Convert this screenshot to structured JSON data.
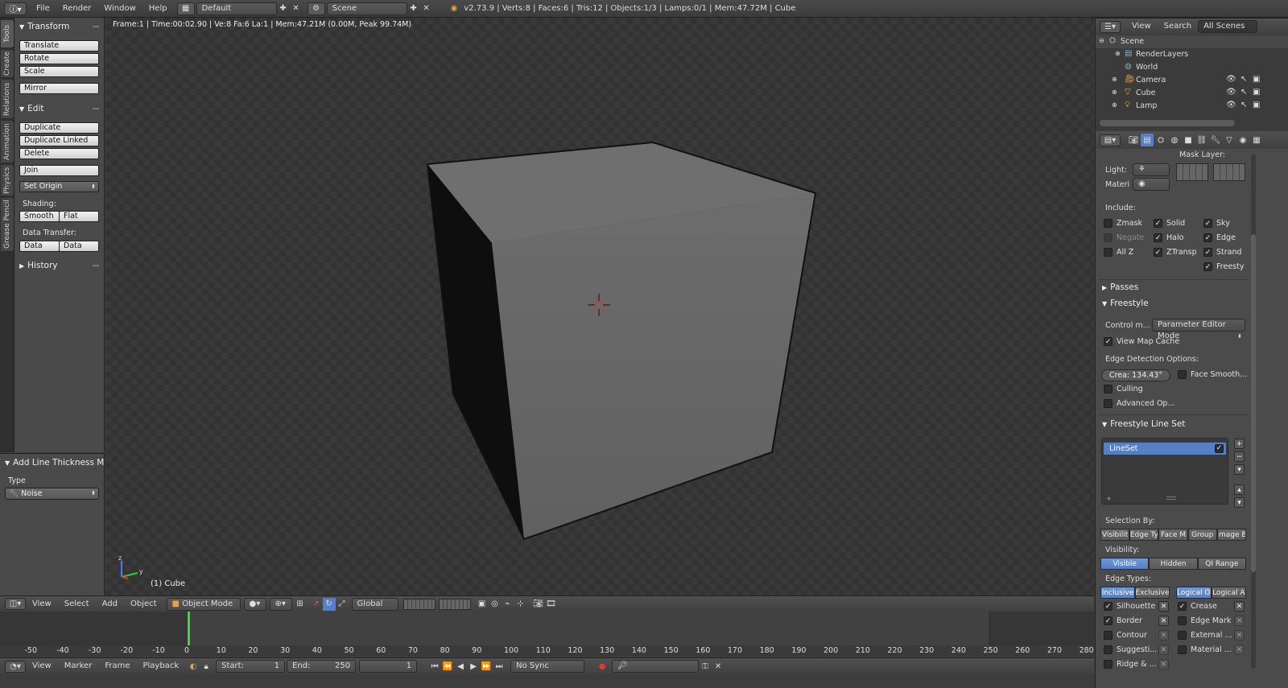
{
  "topbar": {
    "menus": [
      "File",
      "Render",
      "Window",
      "Help"
    ],
    "screen_layout": "Default",
    "scene": "Scene",
    "info": "v2.73.9 | Verts:8 | Faces:6 | Tris:12 | Objects:1/3 | Lamps:0/1 | Mem:47.72M | Cube"
  },
  "tabs": [
    "Tools",
    "Create",
    "Relations",
    "Animation",
    "Physics",
    "Grease Pencil"
  ],
  "shelf": {
    "transform": {
      "title": "Transform",
      "buttons": [
        "Translate",
        "Rotate",
        "Scale",
        "Mirror"
      ]
    },
    "edit": {
      "title": "Edit",
      "buttons": [
        "Duplicate",
        "Duplicate Linked",
        "Delete",
        "Join"
      ],
      "set_origin": "Set Origin"
    },
    "shading_label": "Shading:",
    "shading": [
      "Smooth",
      "Flat"
    ],
    "data_transfer_label": "Data Transfer:",
    "data_transfer": [
      "Data",
      "Data Layo"
    ],
    "history": "History"
  },
  "operator": {
    "title": "Add Line Thickness Mod",
    "type_label": "Type",
    "type_value": "Noise"
  },
  "viewport": {
    "stats": "Frame:1 | Time:00:02.90 | Ve:8 Fa:6 La:1 | Mem:47.21M (0.00M, Peak 99.74M)",
    "object_name": "(1) Cube",
    "axis_labels": {
      "z": "z",
      "y": "y",
      "x": "x"
    }
  },
  "view3d_header": {
    "menus": [
      "View",
      "Select",
      "Add",
      "Object"
    ],
    "mode": "Object Mode",
    "orientation": "Global"
  },
  "timeline": {
    "ticks": [
      "-50",
      "-40",
      "-30",
      "-20",
      "-10",
      "0",
      "10",
      "20",
      "30",
      "40",
      "50",
      "60",
      "70",
      "80",
      "90",
      "100",
      "110",
      "120",
      "130",
      "140",
      "150",
      "160",
      "170",
      "180",
      "190",
      "200",
      "210",
      "220",
      "230",
      "240",
      "250",
      "260",
      "270",
      "280"
    ],
    "menus": [
      "View",
      "Marker",
      "Frame",
      "Playback"
    ],
    "start_label": "Start:",
    "start": "1",
    "end_label": "End:",
    "end": "250",
    "current": "1",
    "sync": "No Sync"
  },
  "outliner": {
    "menus": [
      "View",
      "Search"
    ],
    "filter": "All Scenes",
    "items": [
      "Scene",
      "RenderLayers",
      "World",
      "Camera",
      "Cube",
      "Lamp"
    ]
  },
  "props": {
    "mask_layer": "Mask Layer:",
    "light_label": "Light:",
    "material_label": "Materi",
    "include_label": "Include:",
    "include_col1": [
      "Zmask",
      "Negate",
      "All Z"
    ],
    "include_col2": [
      "Solid",
      "Halo",
      "ZTransp"
    ],
    "include_col3": [
      "Sky",
      "Edge",
      "Strand",
      "Freesty"
    ],
    "passes": "Passes",
    "freestyle": "Freestyle",
    "control_mode_label": "Control m...",
    "control_mode": "Parameter Editor Mode",
    "view_map_cache": "View Map Cache",
    "edge_detection": "Edge Detection Options:",
    "crease": "Crea: 134.43°",
    "face_smooth": "Face Smooth...",
    "culling": "Culling",
    "advanced": "Advanced Op...",
    "lineset_panel": "Freestyle Line Set",
    "lineset": "LineSet",
    "selection_by": "Selection By:",
    "selection_tabs": [
      "Visibilit",
      "Edge Ty",
      "Face M",
      "Group",
      "Image B"
    ],
    "visibility": "Visibility:",
    "visibility_tabs": [
      "Visible",
      "Hidden",
      "QI Range"
    ],
    "edge_types": "Edge Types:",
    "edge_mode_a": [
      "Inclusive",
      "Exclusive"
    ],
    "edge_mode_b": [
      "Logical O",
      "Logical A"
    ],
    "edges_left": [
      "Silhouette",
      "Border",
      "Contour",
      "Suggesti...",
      "Ridge & ..."
    ],
    "edges_right": [
      "Crease",
      "Edge Mark",
      "External ...",
      "Material ..."
    ]
  },
  "colors": {
    "accent": "#5680c4",
    "background": "#3d3d3d",
    "panel": "#4a4a4a",
    "timeline_cursor": "#3fd63f"
  }
}
